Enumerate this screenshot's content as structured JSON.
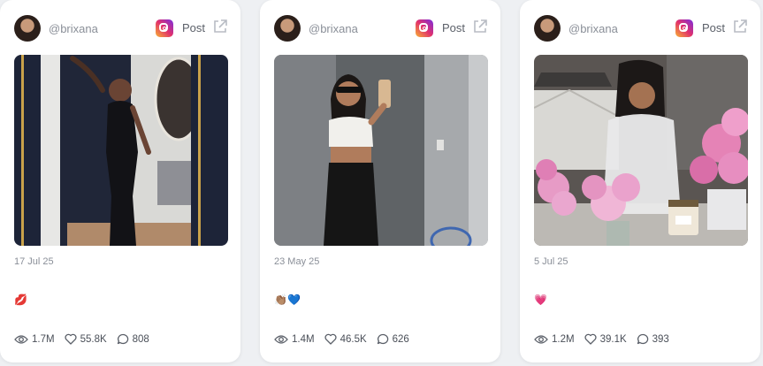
{
  "post_label": "Post",
  "cards": [
    {
      "handle": "@brixana",
      "date": "17 Jul 25",
      "emoji": "💋",
      "views": "1.7M",
      "likes": "55.8K",
      "comments": "808"
    },
    {
      "handle": "@brixana",
      "date": "23 May 25",
      "emoji": "👏🏽💙",
      "views": "1.4M",
      "likes": "46.5K",
      "comments": "626"
    },
    {
      "handle": "@brixana",
      "date": "5 Jul 25",
      "emoji": "💗",
      "views": "1.2M",
      "likes": "39.1K",
      "comments": "393"
    }
  ],
  "colors": {
    "instagram_gradient": [
      "#f9b233",
      "#e1306c",
      "#7a2ee0"
    ],
    "card_bg": "#ffffff",
    "page_bg": "#eef0f3"
  }
}
